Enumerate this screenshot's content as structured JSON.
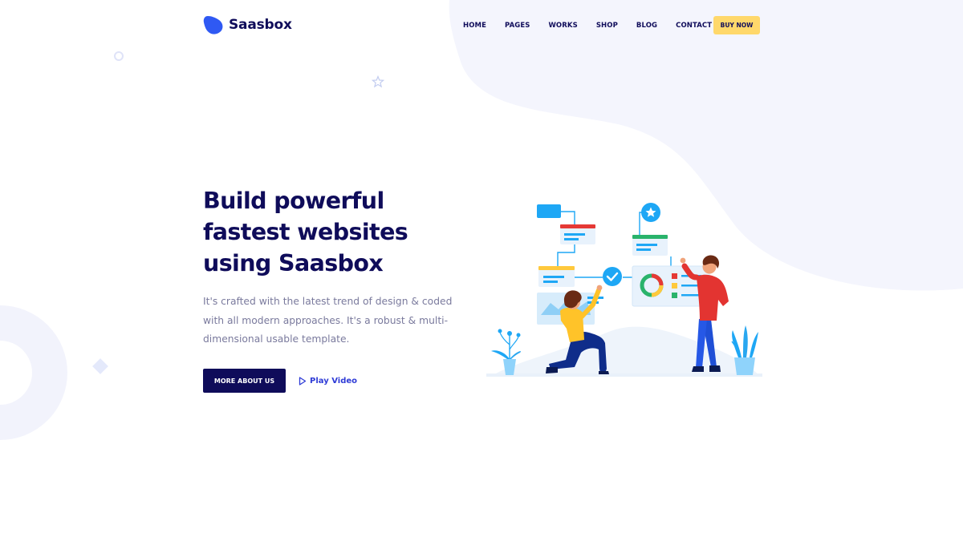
{
  "brand": {
    "name": "Saasbox"
  },
  "nav": {
    "items": [
      {
        "label": "HOME"
      },
      {
        "label": "PAGES"
      },
      {
        "label": "WORKS"
      },
      {
        "label": "SHOP"
      },
      {
        "label": "BLOG"
      },
      {
        "label": "CONTACT"
      }
    ],
    "cta_label": "BUY NOW"
  },
  "hero": {
    "title_lines": [
      "Build powerful",
      "fastest websites",
      "using Saasbox"
    ],
    "description_lines": [
      "It's crafted with the latest trend of design & coded",
      "with all modern approaches. It's a robust & multi-",
      "dimensional usable template."
    ],
    "primary_button": "MORE ABOUT US",
    "video_link": "Play Video"
  },
  "colors": {
    "navy": "#0f0c5a",
    "cta_yellow": "#ffd86b",
    "link_blue": "#2e3bd6",
    "bg_blob": "#f3f4fd",
    "logo_blue": "#2f59f3"
  },
  "icons": {
    "logo": "logo-blob-icon",
    "play": "play-triangle-icon"
  }
}
